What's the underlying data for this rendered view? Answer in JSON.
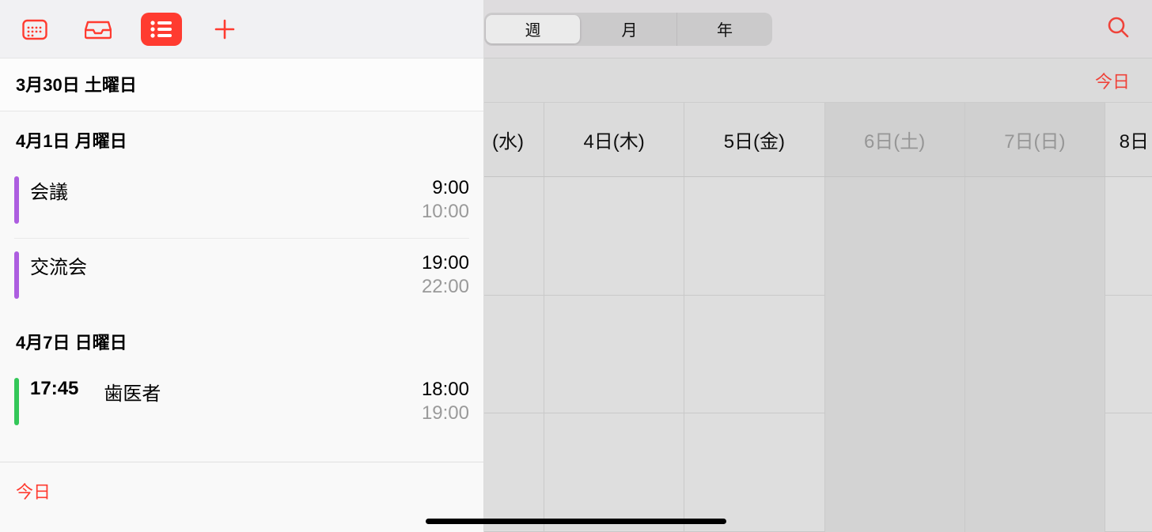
{
  "accent": "#ff3b30",
  "sidebar": {
    "footer_today": "今日",
    "sections": [
      {
        "date": "3月30日 土曜日",
        "highlight": true,
        "events": []
      },
      {
        "date": "4月1日 月曜日",
        "highlight": false,
        "events": [
          {
            "color": "purple",
            "title": "会議",
            "start": "9:00",
            "end": "10:00"
          },
          {
            "color": "purple",
            "title": "交流会",
            "start": "19:00",
            "end": "22:00"
          }
        ]
      },
      {
        "date": "4月7日 日曜日",
        "highlight": false,
        "events": [
          {
            "color": "green",
            "alert_time": "17:45",
            "title": "歯医者",
            "start": "18:00",
            "end": "19:00"
          }
        ]
      }
    ]
  },
  "right": {
    "segmented": {
      "week": "週",
      "month": "月",
      "year": "年",
      "active": "week"
    },
    "today_label": "今日",
    "days": [
      {
        "label": "(水)",
        "weekend": false,
        "partial": true
      },
      {
        "label": "4日(木)",
        "weekend": false
      },
      {
        "label": "5日(金)",
        "weekend": false
      },
      {
        "label": "6日(土)",
        "weekend": true
      },
      {
        "label": "7日(日)",
        "weekend": true
      },
      {
        "label": "8日",
        "weekend": false,
        "partial": true,
        "cut": true
      }
    ]
  }
}
